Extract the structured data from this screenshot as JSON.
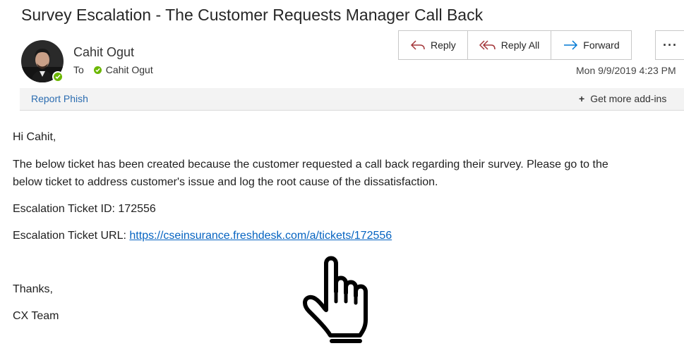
{
  "email": {
    "subject": "Survey Escalation - The Customer Requests Manager Call Back",
    "sender_name": "Cahit Ogut",
    "to_label": "To",
    "recipient_name": "Cahit Ogut",
    "date": "Mon 9/9/2019 4:23 PM"
  },
  "toolbar": {
    "reply_label": "Reply",
    "reply_all_label": "Reply All",
    "forward_label": "Forward",
    "more_label": "···"
  },
  "addins": {
    "report_phish_label": "Report Phish",
    "get_more_label": "Get more add-ins",
    "plus_symbol": "+"
  },
  "message": {
    "greeting": "Hi Cahit,",
    "paragraph_line1": "The below ticket has been created because the customer requested a call back regarding their survey. Please go to the",
    "paragraph_line2": "below ticket to address customer's issue and log the root cause of the dissatisfaction.",
    "ticket_id_line": "Escalation Ticket ID: 172556",
    "ticket_url_label": "Escalation Ticket URL: ",
    "ticket_url": "https://cseinsurance.freshdesk.com/a/tickets/172556",
    "thanks": "Thanks,",
    "signature": "CX Team"
  },
  "icons": {
    "reply": "reply-arrow-icon",
    "reply_all": "reply-all-arrow-icon",
    "forward": "forward-arrow-icon",
    "presence": "presence-available-icon",
    "pointer": "hand-pointer-cursor-icon"
  },
  "colors": {
    "accent_blue": "#2b6cb0",
    "link_blue": "#0563c1",
    "presence_green": "#6bb700",
    "reply_icon": "#a4373a",
    "forward_icon": "#0078d4"
  }
}
